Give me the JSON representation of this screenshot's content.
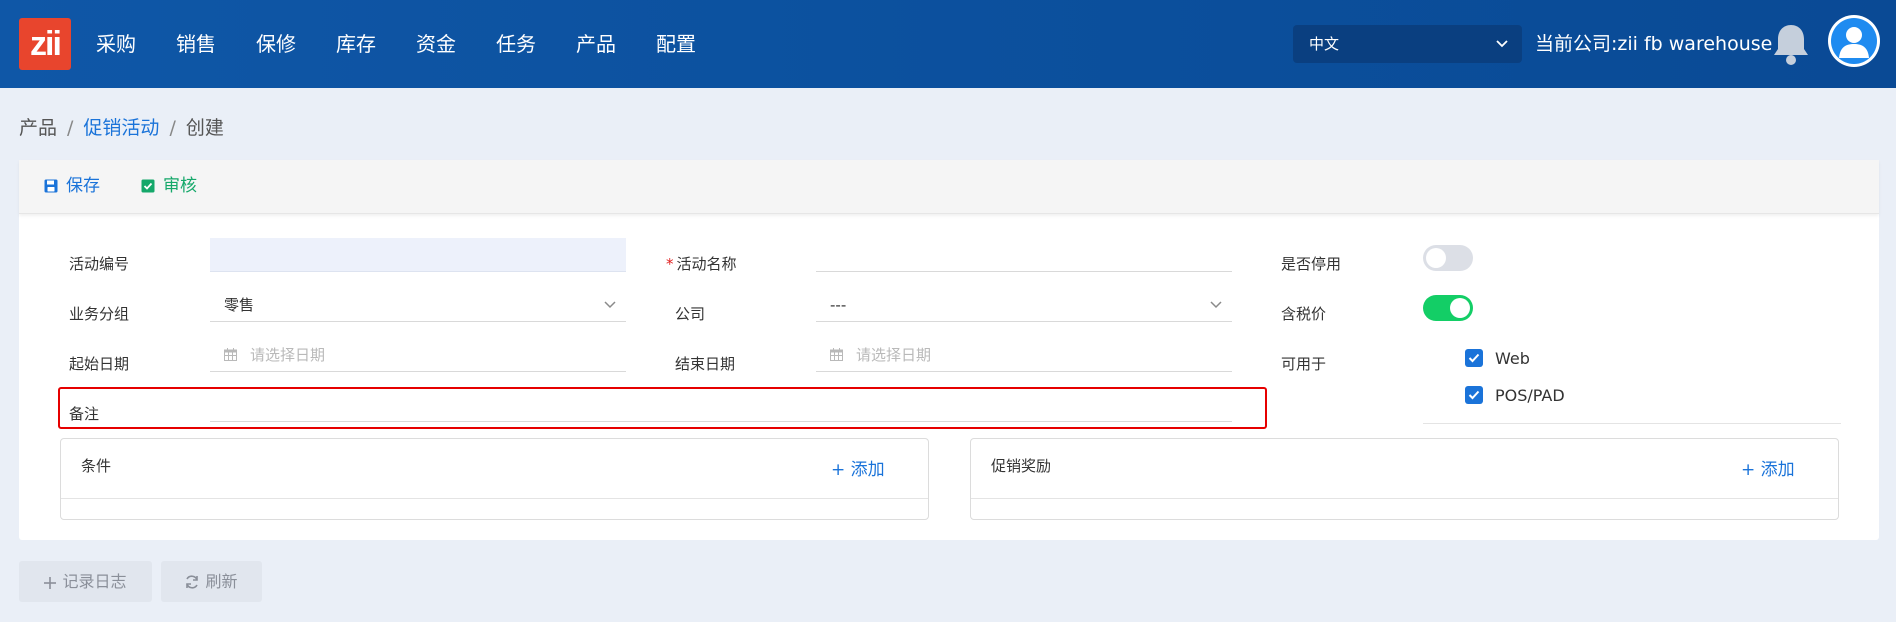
{
  "header": {
    "logo_text": "zii",
    "nav": [
      "采购",
      "销售",
      "保修",
      "库存",
      "资金",
      "任务",
      "产品",
      "配置"
    ],
    "language": "中文",
    "company": "当前公司:zii fb warehouse"
  },
  "breadcrumb": {
    "root": "产品",
    "parent": "促销活动",
    "current": "创建"
  },
  "toolbar": {
    "save_label": "保存",
    "audit_label": "审核"
  },
  "form": {
    "activity_code": {
      "label": "活动编号",
      "value": ""
    },
    "activity_name": {
      "label": "活动名称",
      "value": ""
    },
    "disabled": {
      "label": "是否停用",
      "state": "off"
    },
    "business_group": {
      "label": "业务分组",
      "value": "零售"
    },
    "company": {
      "label": "公司",
      "value": "---"
    },
    "tax_included": {
      "label": "含税价",
      "state": "on"
    },
    "start_date": {
      "label": "起始日期",
      "placeholder": "请选择日期"
    },
    "end_date": {
      "label": "结束日期",
      "placeholder": "请选择日期"
    },
    "available_for": {
      "label": "可用于",
      "options": [
        "Web",
        "POS/PAD"
      ]
    },
    "remark": {
      "label": "备注",
      "value": ""
    }
  },
  "panels": {
    "conditions": {
      "title": "条件",
      "add_label": "添加"
    },
    "rewards": {
      "title": "促销奖励",
      "add_label": "添加"
    }
  },
  "footer": {
    "log_label": "记录日志",
    "refresh_label": "刷新"
  },
  "colors": {
    "header_bg": "#0f57a7",
    "accent": "#1a73d9",
    "success": "#13ce66",
    "highlight": "#e60000"
  }
}
